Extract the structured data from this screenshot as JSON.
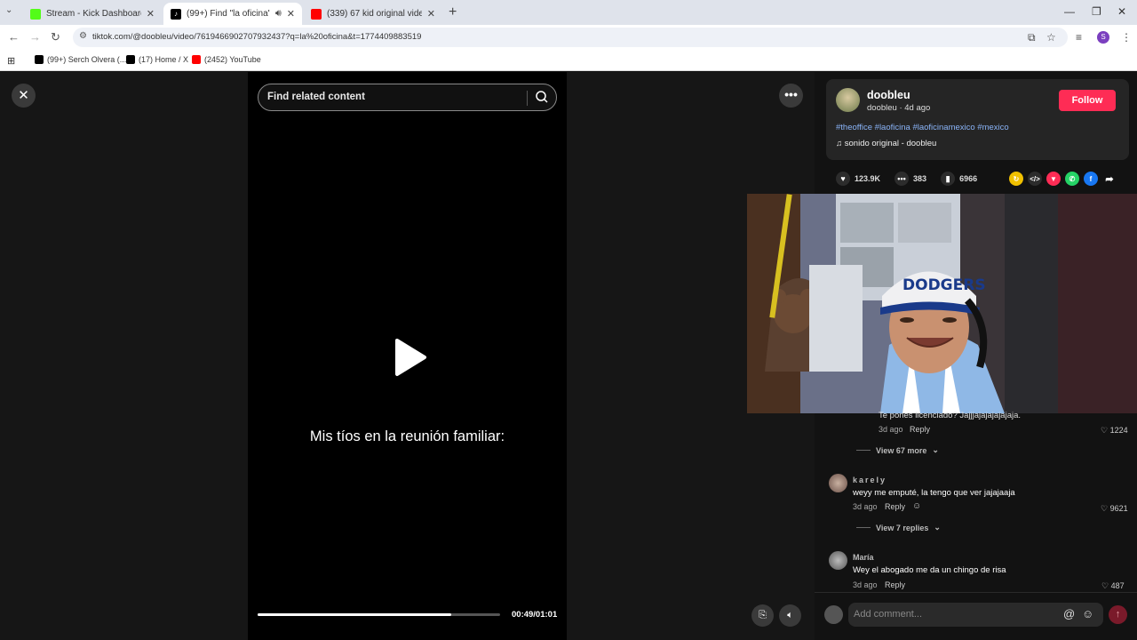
{
  "browser": {
    "tabs": [
      {
        "title": "Stream - Kick Dashboard",
        "color": "#53fc18"
      },
      {
        "title": "(99+) Find \"la oficina\" on Tik",
        "color": "#000000"
      },
      {
        "title": "(339) 67 kid original video - Yo",
        "color": "#ff0000"
      }
    ],
    "url": "tiktok.com/@doobleu/video/7619466902707932437?q=la%20oficina&t=1774409883519",
    "profile_initial": "S",
    "bookmarks": [
      {
        "label": "(99+) Serch Olvera (...",
        "color": "#000000"
      },
      {
        "label": "(17) Home / X",
        "color": "#000000"
      },
      {
        "label": "(2452) YouTube",
        "color": "#ff0000"
      }
    ]
  },
  "video": {
    "search_placeholder": "Find related content",
    "caption": "Mis tíos en la reunión familiar:",
    "progress": 0.8,
    "time": "00:49/01:01"
  },
  "post": {
    "username": "doobleu",
    "meta": "doobleu · 4d ago",
    "follow_label": "Follow",
    "hashtags": "#theoffice #laoficina #laoficinamexico #mexico",
    "sound": "sonido original - doobleu",
    "likes": "123.9K",
    "comments": "383",
    "saves": "6966"
  },
  "comments": {
    "partial_text": "Te pones licenciado? Jajjjajajajajajaja.",
    "partial_date": "3d ago",
    "partial_reply": "Reply",
    "partial_likes": "1224",
    "view_more_1": "View 67 more",
    "c1_author": "karely",
    "c1_text": "weyy me emputé, la tengo que ver jajajaaja",
    "c1_date": "3d ago",
    "c1_reply": "Reply",
    "c1_likes": "9621",
    "view_more_2": "View 7 replies",
    "c2_author": "María",
    "c2_text": "Wey el abogado me da un chingo de risa",
    "c2_date": "3d ago",
    "c2_reply": "Reply",
    "c2_likes": "487"
  },
  "comment_input": {
    "placeholder": "Add comment..."
  },
  "webcam": {
    "cap_text": "DODGERS"
  }
}
